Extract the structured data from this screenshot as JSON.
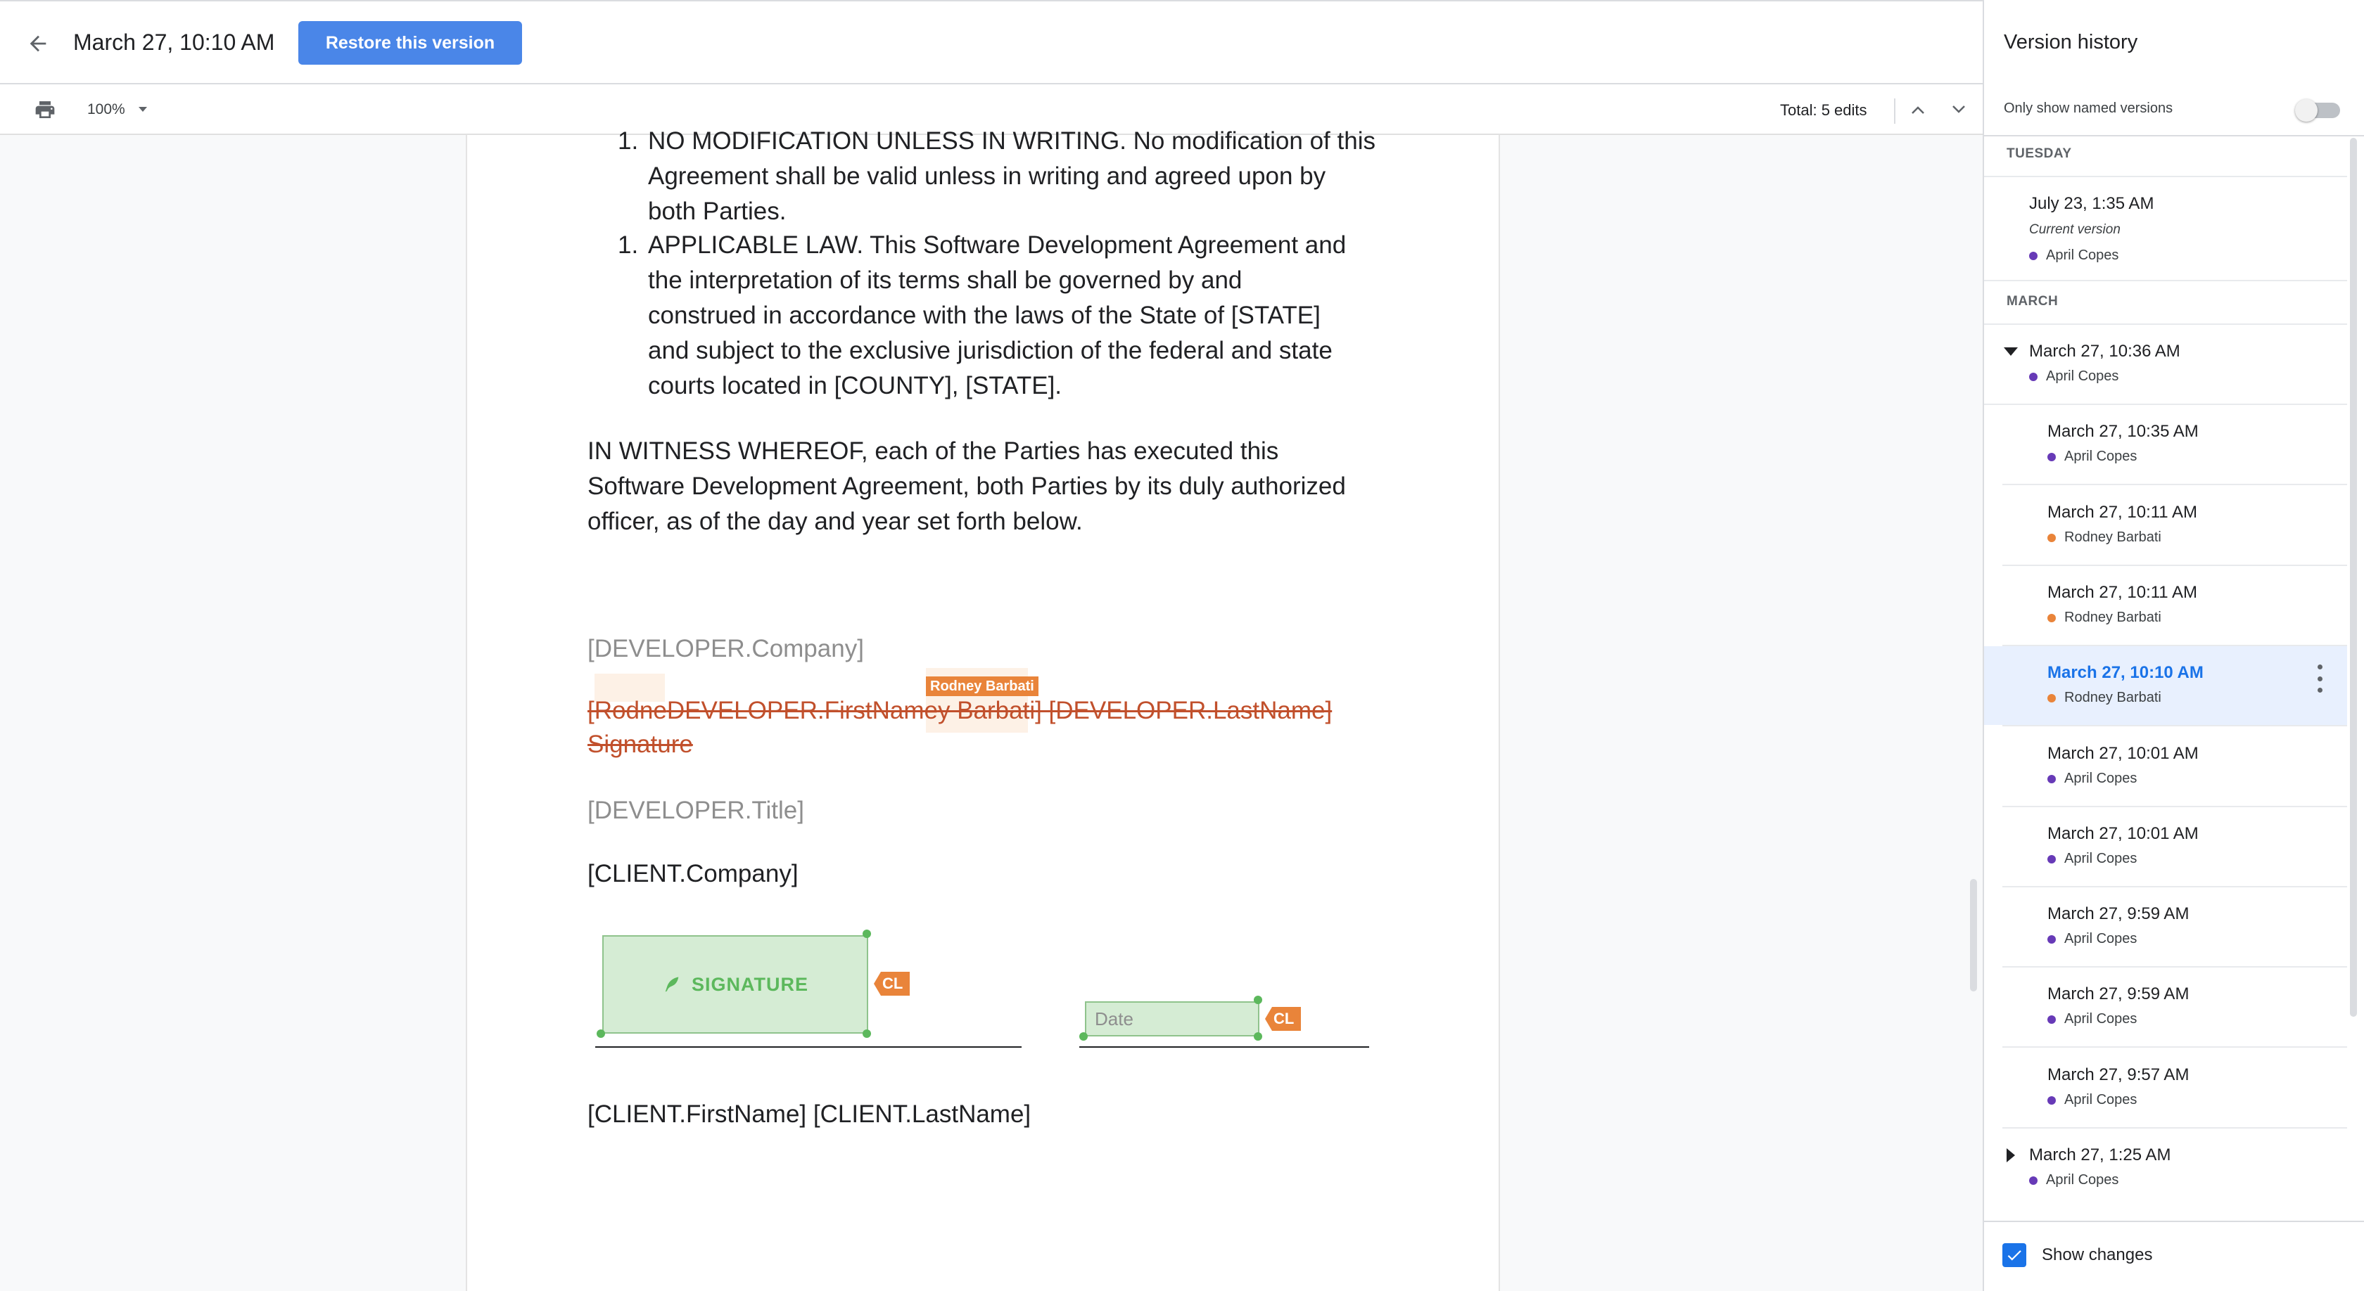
{
  "header": {
    "title": "March 27, 10:10 AM",
    "restore_label": "Restore this version"
  },
  "toolbar": {
    "zoom": "100%",
    "total_edits": "Total: 5 edits"
  },
  "document": {
    "clauses": [
      {
        "num": "1.",
        "lines": [
          "NO MODIFICATION UNLESS IN WRITING. No modification of this",
          "Agreement shall be valid unless in writing and agreed upon by",
          "both Parties."
        ]
      },
      {
        "num": "1.",
        "lines": [
          "APPLICABLE LAW. This Software Development Agreement and",
          "the interpretation of its terms shall be governed by and",
          "construed in accordance with the laws of the State of [STATE]",
          "and subject to the exclusive jurisdiction of the federal and state",
          "courts located in [COUNTY], [STATE]."
        ]
      }
    ],
    "witness": [
      "IN WITNESS WHEREOF, each of the Parties has executed this",
      "Software Development Agreement, both Parties by its duly authorized",
      "officer, as of the day and year set forth below."
    ],
    "dev_company": "[DEVELOPER.Company]",
    "change_author": "Rodney Barbati",
    "deleted_line1_a": "[Rodne",
    "deleted_line1_b": "DEVELOPER.FirstName",
    "deleted_line1_c": "y Barbati",
    "deleted_line1_d": "] [DEVELOPER.LastName] ",
    "deleted_line2": "Signature",
    "dev_title": "[DEVELOPER.Title]",
    "client_company": "[CLIENT.Company]",
    "signature_field": "SIGNATURE",
    "date_placeholder": "Date",
    "role_tag": "CL",
    "client_name": "[CLIENT.FirstName] [CLIENT.LastName]"
  },
  "sidebar": {
    "title": "Version history",
    "named_only_label": "Only show named versions",
    "named_only_on": false,
    "sections": [
      "TUESDAY",
      "MARCH"
    ],
    "current": {
      "time": "July 23, 1:35 AM",
      "subtitle": "Current version",
      "author": "April Copes"
    },
    "versions": [
      {
        "time": "March 27, 10:36 AM",
        "author": "April Copes"
      },
      {
        "time": "March 27, 10:35 AM",
        "author": "April Copes"
      },
      {
        "time": "March 27, 10:11 AM",
        "author": "Rodney Barbati"
      },
      {
        "time": "March 27, 10:11 AM",
        "author": "Rodney Barbati"
      },
      {
        "time": "March 27, 10:10 AM",
        "author": "Rodney Barbati"
      },
      {
        "time": "March 27, 10:01 AM",
        "author": "April Copes"
      },
      {
        "time": "March 27, 10:01 AM",
        "author": "April Copes"
      },
      {
        "time": "March 27, 9:59 AM",
        "author": "April Copes"
      },
      {
        "time": "March 27, 9:59 AM",
        "author": "April Copes"
      },
      {
        "time": "March 27, 9:57 AM",
        "author": "April Copes"
      },
      {
        "time": "March 27, 1:25 AM",
        "author": "April Copes"
      }
    ],
    "show_changes_label": "Show changes",
    "show_changes_checked": true
  },
  "colors": {
    "accent": "#4a86e8",
    "selected_text": "#1a73e8",
    "author_april": "#673ab7",
    "author_rodney": "#e9843a",
    "deletion": "#c1502c"
  },
  "icons": [
    "arrow-back-icon",
    "print-icon",
    "chevron-down-icon",
    "chevron-up-icon",
    "pen-icon",
    "check-icon",
    "more-vert-icon",
    "triangle-down-icon",
    "triangle-right-icon"
  ]
}
